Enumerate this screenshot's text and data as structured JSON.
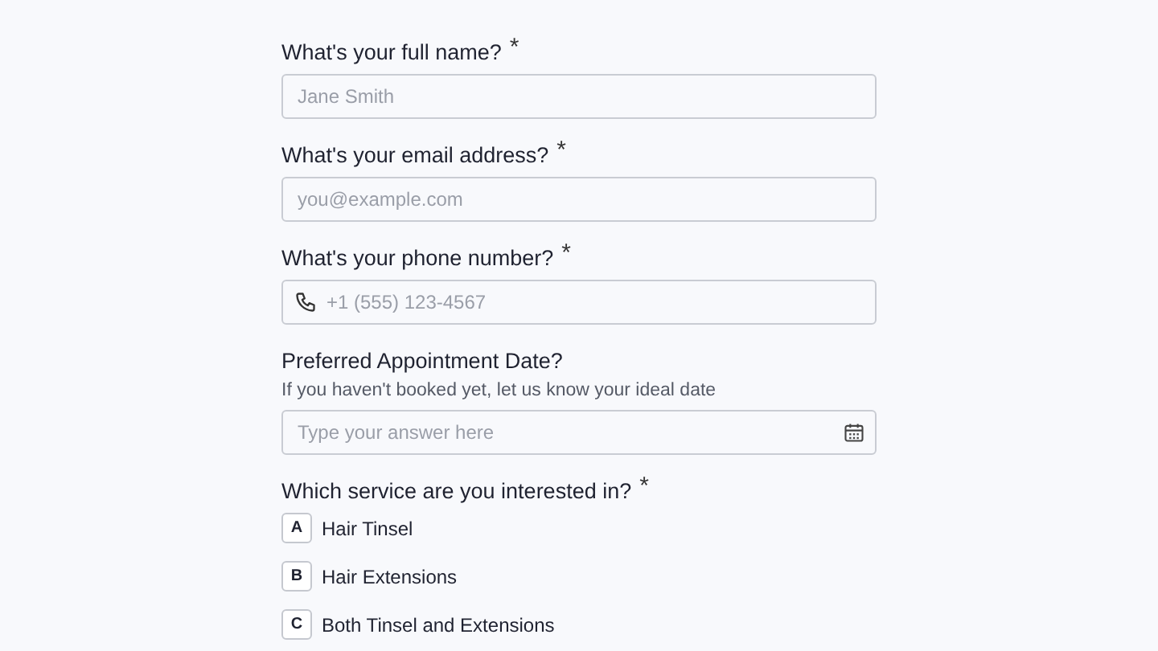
{
  "questions": [
    {
      "kind": "text",
      "label": "What's your full name?",
      "mark": "*",
      "placeholder": "Jane Smith"
    },
    {
      "kind": "text",
      "label": "What's your email address?",
      "mark": "*",
      "placeholder": "you@example.com"
    },
    {
      "kind": "phone",
      "label": "What's your phone number?",
      "mark": "*",
      "placeholder": "+1 (555) 123-4567"
    },
    {
      "kind": "date",
      "label": "Preferred Appointment Date?",
      "hint": "If you haven't booked yet, let us know your ideal date",
      "placeholder": "Type your answer here"
    },
    {
      "kind": "choice",
      "label": "Which service are you interested in?",
      "mark": "*",
      "options": [
        {
          "key": "A",
          "label": "Hair Tinsel",
          "selected": false
        },
        {
          "key": "B",
          "label": "Hair Extensions",
          "selected": false
        },
        {
          "key": "C",
          "label": "Both Tinsel and Extensions",
          "selected": false
        }
      ]
    }
  ]
}
